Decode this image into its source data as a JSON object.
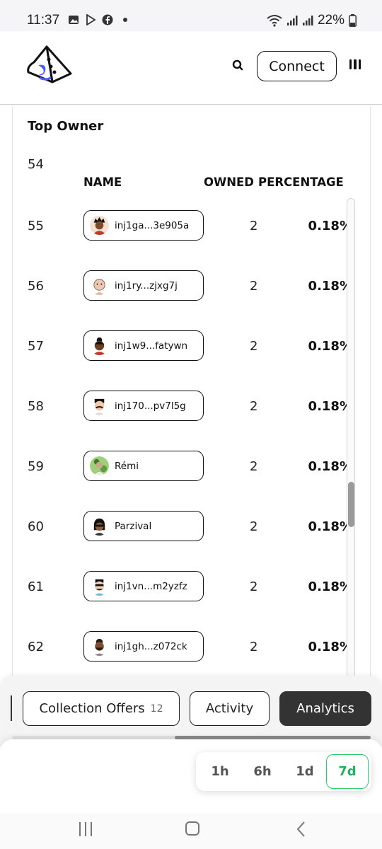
{
  "status_bar": {
    "time": "11:37",
    "battery": "22%",
    "icons": [
      "gallery-icon",
      "play-store-icon",
      "facebook-icon",
      "dot-icon",
      "wifi-icon",
      "signal-icon",
      "signal-icon",
      "battery-icon"
    ]
  },
  "header": {
    "logo_icon": "sail-logo-icon",
    "search_icon": "search-icon",
    "connect_label": "Connect",
    "menu_icon": "menu-icon"
  },
  "top_owner": {
    "title": "Top Owner",
    "partial_rank_above": "54",
    "columns": {
      "name": "NAME",
      "owned": "OWNED",
      "percentage": "PERCENTAGE"
    },
    "rows": [
      {
        "rank": "55",
        "name": "inj1ga...3e905a",
        "owned": "2",
        "percentage": "0.18%",
        "avatar": "avatar-black-curly-hair"
      },
      {
        "rank": "56",
        "name": "inj1ry...zjxg7j",
        "owned": "2",
        "percentage": "0.18%",
        "avatar": "avatar-bald-pink"
      },
      {
        "rank": "57",
        "name": "inj1w9...fatywn",
        "owned": "2",
        "percentage": "0.18%",
        "avatar": "avatar-bun-hair"
      },
      {
        "rank": "58",
        "name": "inj170...pv7l5g",
        "owned": "2",
        "percentage": "0.18%",
        "avatar": "avatar-mustache"
      },
      {
        "rank": "59",
        "name": "Rémi",
        "owned": "2",
        "percentage": "0.18%",
        "avatar": "avatar-green-photo"
      },
      {
        "rank": "60",
        "name": "Parzival",
        "owned": "2",
        "percentage": "0.18%",
        "avatar": "avatar-sunglasses-dark"
      },
      {
        "rank": "61",
        "name": "inj1vn...m2yzfz",
        "owned": "2",
        "percentage": "0.18%",
        "avatar": "avatar-sunglasses-beard"
      },
      {
        "rank": "62",
        "name": "inj1gh...z072ck",
        "owned": "2",
        "percentage": "0.18%",
        "avatar": "avatar-brown-beard"
      }
    ],
    "scroll_position": 0.55
  },
  "tabs": {
    "items": [
      {
        "label": "Collection Offers",
        "count": "12",
        "active": false
      },
      {
        "label": "Activity",
        "count": "",
        "active": false
      },
      {
        "label": "Analytics",
        "count": "",
        "active": true
      }
    ],
    "scroll_progress": 0.55
  },
  "time_filter": {
    "options": [
      "1h",
      "6h",
      "1d",
      "7d"
    ],
    "selected": "7d",
    "accent_color": "#2ecc71"
  },
  "android_nav": {
    "icons": [
      "recent-apps-icon",
      "home-icon",
      "back-icon"
    ]
  }
}
